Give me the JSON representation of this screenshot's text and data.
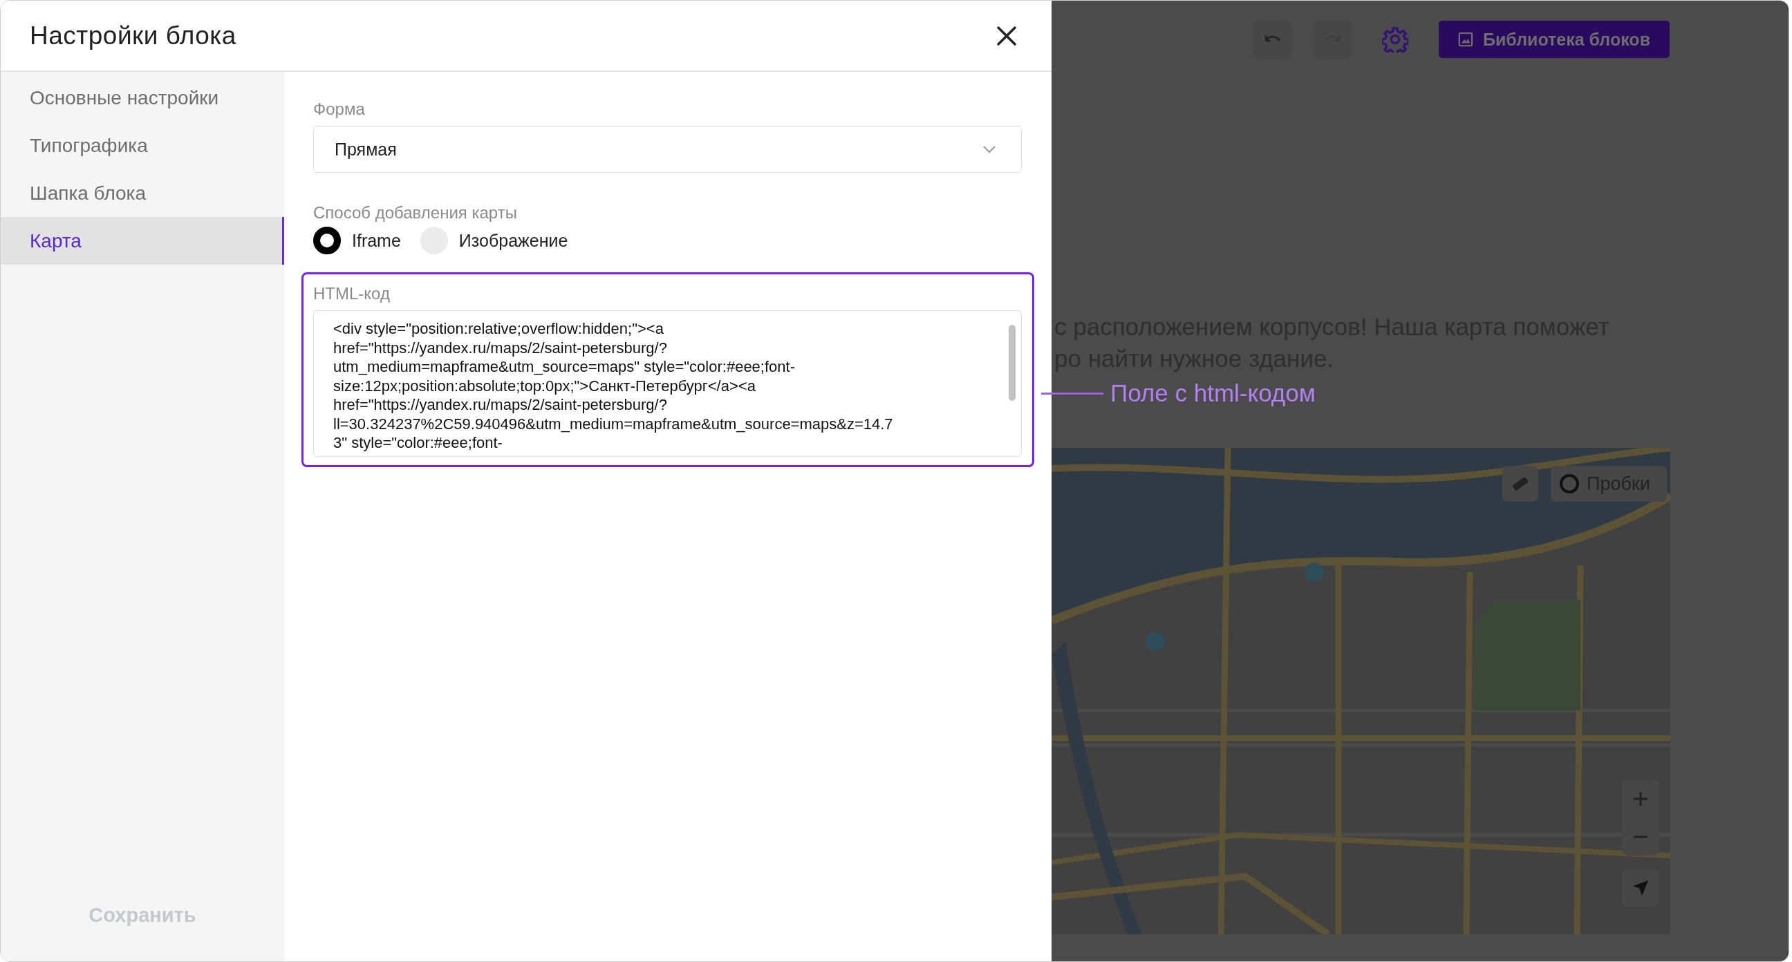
{
  "dialog": {
    "title": "Настройки блока"
  },
  "sidebar": {
    "items": [
      {
        "label": "Основные настройки",
        "selected": false
      },
      {
        "label": "Типографика",
        "selected": false
      },
      {
        "label": "Шапка блока",
        "selected": false
      },
      {
        "label": "Карта",
        "selected": true
      }
    ],
    "save_button": {
      "label": "Сохранить",
      "disabled": true
    }
  },
  "form": {
    "shape": {
      "label": "Форма",
      "value": "Прямая"
    },
    "method": {
      "label": "Способ добавления карты",
      "options": [
        {
          "label": "Iframe",
          "selected": true
        },
        {
          "label": "Изображение",
          "selected": false
        }
      ]
    },
    "html_code": {
      "label": "HTML-код",
      "highlighted": true,
      "lines": [
        "<div style=\"position:relative;overflow:hidden;\"><a",
        "href=\"https://yandex.ru/maps/2/saint-petersburg/?",
        "utm_medium=mapframe&utm_source=maps\" style=\"color:#eee;font-",
        "size:12px;position:absolute;top:0px;\">Санкт-Петербург</a><a",
        "href=\"https://yandex.ru/maps/2/saint-petersburg/?",
        "ll=30.324237%2C59.940496&utm_medium=mapframe&utm_source=maps&z=14.7",
        "3\" style=\"color:#eee;font-"
      ]
    }
  },
  "annotation": {
    "text": "Поле с html-кодом"
  },
  "background": {
    "library_button": "Библиотека блоков",
    "text_lines": [
      "с расположением корпусов! Наша карта поможет",
      "ро найти нужное здание."
    ],
    "map": {
      "kind": "picture",
      "traffic_button": "Пробки"
    }
  }
}
